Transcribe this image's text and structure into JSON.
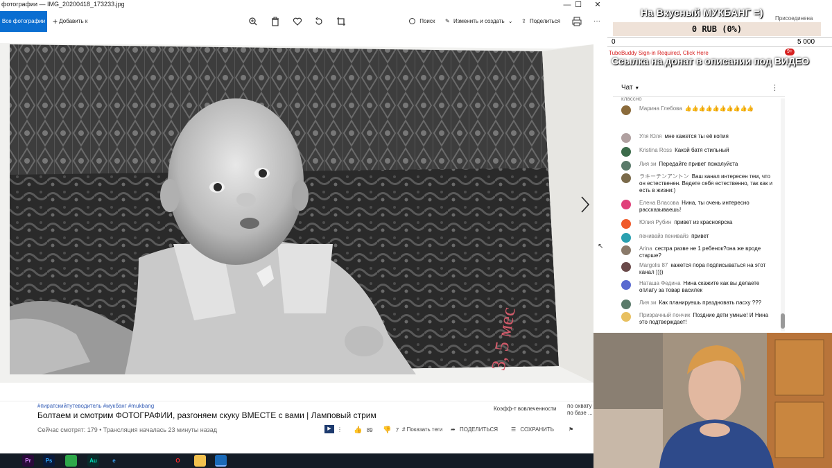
{
  "photos_window": {
    "title": "фотографии — IMG_20200418_173233.jpg",
    "minimize": "—",
    "maximize": "☐",
    "close": "✕",
    "toolbar": {
      "all_photos": "Все фотографии",
      "add_to": "Добавить к",
      "search": "Поиск",
      "edit_create": "Изменить и создать",
      "share": "Поделиться",
      "more": "···"
    },
    "photo_annotation": "3, 5 мес",
    "icons": [
      "zoom-icon",
      "delete-icon",
      "heart-icon",
      "rotate-icon",
      "crop-icon",
      "print-icon",
      "next-arrow-icon"
    ]
  },
  "youtube": {
    "hashtags": "#пиратскийпутеводитель #мукбанг #mukbang",
    "title": "Болтаем и смотрим ФОТОГРАФИИ, разгоняем скуку ВМЕСТЕ с вами | Ламповый стрим",
    "watching": "Сейчас смотрят: 179 • Трансляция началась 23 минуты назад",
    "likes": "89",
    "dislikes": "7",
    "show_tags": "# Показать теги",
    "share": "ПОДЕЛИТЬСЯ",
    "save": "СОХРАНИТЬ",
    "engagement": "Коэфф-т вовлеченности",
    "coverage_line1": "по охвату",
    "coverage_line2": "по базе ..."
  },
  "overlay": {
    "banner": "На Вкусный МУКБАНГ =)",
    "donate_sum": "0 RUB (0%)",
    "donate_left": "0",
    "donate_right": "5 000",
    "tubebuddy": "TubeBuddy Sign-in Required, Click Here",
    "donate_link": "Ссылка на донат в описании под ВИДЕО",
    "notification_badge": "9+",
    "subscribed": "Присоединена"
  },
  "chat": {
    "title": "Чат",
    "partial_top": "классно",
    "messages": [
      {
        "author": "Марина Глебова",
        "text": "👍👍👍👍👍👍👍👍👍👍",
        "color": "#8b6b3b"
      },
      {
        "author": "Уля Юля",
        "text": "мне кажется ты её копия",
        "color": "#b0a0a0"
      },
      {
        "author": "Kristina Ross",
        "text": "Какой батя стильный",
        "color": "#3c6b4a"
      },
      {
        "author": "Лия зи",
        "text": "Передайте привет пожалуйста",
        "color": "#5a7a6a"
      },
      {
        "author": "ラキーチンアントン",
        "text": "Ваш канал интересен тем, что он естественен. Ведете себя естественно, так как и есть в жизни:)",
        "color": "#7a6a4a"
      },
      {
        "author": "Елена Власова",
        "text": "Нина, ты очень интересно рассказываешь!",
        "color": "#e0407a"
      },
      {
        "author": "Юлия Рубин",
        "text": "привет из красноярска",
        "color": "#f05a2a"
      },
      {
        "author": "пенивайз пенивайз",
        "text": "привет",
        "color": "#2aa0b0"
      },
      {
        "author": "Arina",
        "text": "сестра разве не 1 ребенок?она же вроде старше?",
        "color": "#8a7a6a"
      },
      {
        "author": "Margolis 87",
        "text": "кажется пора подписываться на этот канал ))))",
        "color": "#6a4a4a"
      },
      {
        "author": "Наташа Федина",
        "text": "Нина скажите как вы делаете оплату за товар василек",
        "color": "#5a6ad0"
      },
      {
        "author": "Лия зи",
        "text": "Как планируешь праздновать пасху ???",
        "color": "#5a7a6a"
      },
      {
        "author": "Призрачный пончик",
        "text": "Поздние дети умные! И Нина это подтверждает!",
        "color": "#e8c060"
      }
    ]
  },
  "taskbar": {
    "apps": [
      {
        "name": "premiere-icon",
        "label": "Pr",
        "bg": "#2a0a3a",
        "fg": "#d88aff"
      },
      {
        "name": "photoshop-icon",
        "label": "Ps",
        "bg": "#0a1a3a",
        "fg": "#31a8ff"
      },
      {
        "name": "app-green-icon",
        "label": "",
        "bg": "#2fa84a",
        "fg": "#fff"
      },
      {
        "name": "audition-icon",
        "label": "Au",
        "bg": "#0a2a2a",
        "fg": "#00e4bb"
      },
      {
        "name": "edge-icon",
        "label": "e",
        "bg": "#141c26",
        "fg": "#3aa0f0"
      },
      {
        "name": "obs-icon",
        "label": "",
        "bg": "#141c26",
        "fg": "#ddd"
      },
      {
        "name": "chrome-icon",
        "label": "",
        "bg": "#141c26",
        "fg": "#fff"
      },
      {
        "name": "opera-icon",
        "label": "O",
        "bg": "#141c26",
        "fg": "#ff2a2a"
      },
      {
        "name": "explorer-icon",
        "label": "",
        "bg": "#f2c14e",
        "fg": "#fff"
      },
      {
        "name": "photos-icon",
        "label": "",
        "bg": "#1a6ab8",
        "fg": "#fff"
      }
    ]
  },
  "colors": {
    "accent": "#0a6ed1",
    "taskbar": "#141c26",
    "overlay_text_shadow": "#000000"
  }
}
